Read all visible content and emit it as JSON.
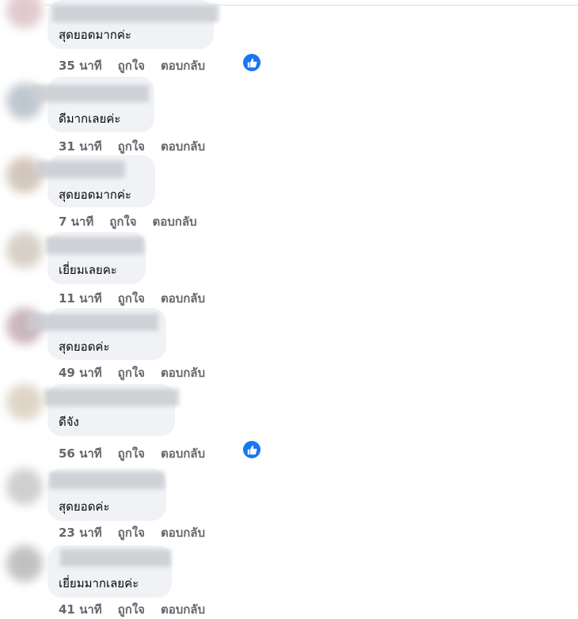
{
  "meta_labels": {
    "like": "ถูกใจ",
    "reply": "ตอบกลับ"
  },
  "comments": [
    {
      "text": "สุดยอดมากค่ะ",
      "time": "35 นาที",
      "liked": true
    },
    {
      "text": "ดีมากเลยค่ะ",
      "time": "31 นาที",
      "liked": false
    },
    {
      "text": "สุดยอดมากค่ะ",
      "time": "7 นาที",
      "liked": false
    },
    {
      "text": "เยี่ยมเลยคะ",
      "time": "11 นาที",
      "liked": false
    },
    {
      "text": "สุดยอดค่ะ",
      "time": "49 นาที",
      "liked": false
    },
    {
      "text": "ดีจัง",
      "time": "56 นาที",
      "liked": true
    },
    {
      "text": "สุดยอดค่ะ",
      "time": "23 นาที",
      "liked": false
    },
    {
      "text": "เยี่ยมมากเลยค่ะ",
      "time": "41 นาที",
      "liked": false
    }
  ],
  "colors": {
    "bubble": "#f0f2f5",
    "meta": "#65676b",
    "like_badge": "#1877f2"
  }
}
